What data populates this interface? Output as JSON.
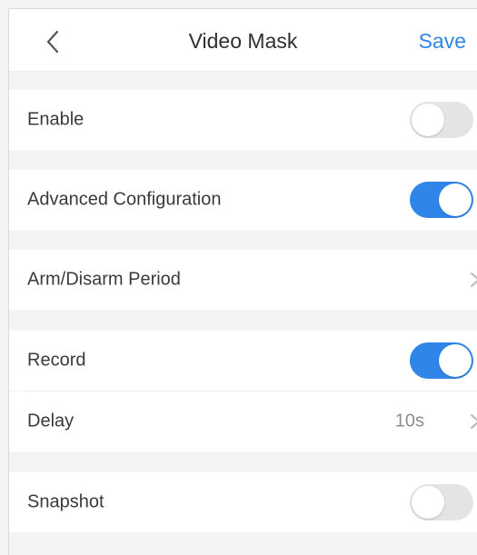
{
  "header": {
    "title": "Video Mask",
    "save_label": "Save",
    "back_icon": "chevron-left-icon"
  },
  "settings": {
    "enable": {
      "label": "Enable",
      "on": false
    },
    "advanced_configuration": {
      "label": "Advanced Configuration",
      "on": true
    },
    "arm_disarm_period": {
      "label": "Arm/Disarm Period",
      "icon": "chevron-right-icon"
    },
    "record": {
      "label": "Record",
      "on": true
    },
    "delay": {
      "label": "Delay",
      "value": "10s",
      "icon": "chevron-right-icon"
    },
    "snapshot": {
      "label": "Snapshot",
      "on": false
    }
  },
  "colors": {
    "accent": "#2f86e8",
    "toggle_off": "#e4e4e4",
    "background": "#f4f4f4",
    "row_background": "#ffffff"
  }
}
